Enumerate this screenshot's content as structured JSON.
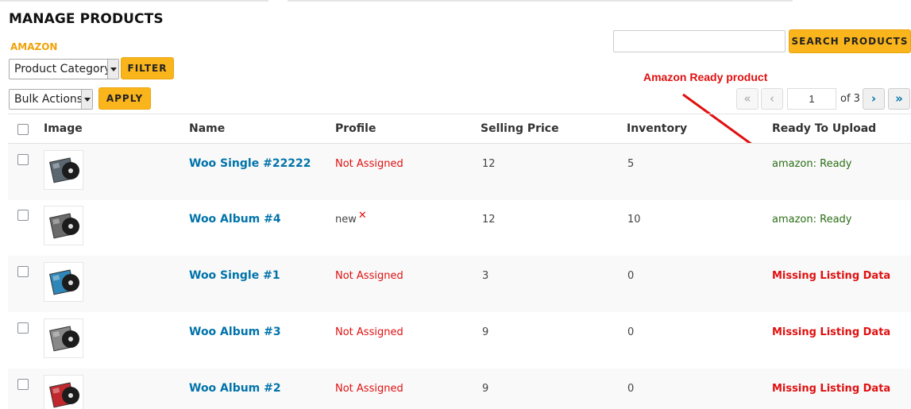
{
  "page": {
    "title": "MANAGE PRODUCTS",
    "section_label": "AMAZON"
  },
  "filters": {
    "category_select": "Product Category",
    "filter_button": "FILTER",
    "bulk_select": "Bulk Actions",
    "apply_button": "APPLY"
  },
  "search": {
    "placeholder": "",
    "button": "SEARCH PRODUCTS"
  },
  "annotation": {
    "text": "Amazon Ready product",
    "color": "#e01010"
  },
  "pagination": {
    "first": "«",
    "prev": "‹",
    "current_page": "1",
    "of_label": "of 3",
    "next": "›",
    "last": "»"
  },
  "table": {
    "columns": [
      "Image",
      "Name",
      "Profile",
      "Selling Price",
      "Inventory",
      "Ready To Upload"
    ],
    "rows": [
      {
        "name": "Woo Single #22222",
        "profile": "Not Assigned",
        "price": "12",
        "inventory": "5",
        "status": "amazon: Ready",
        "status_type": "ready",
        "thumb_color": "#5a6770"
      },
      {
        "name": "Woo Album #4",
        "profile": "new",
        "profile_flag": "✕",
        "price": "12",
        "inventory": "10",
        "status": "amazon: Ready",
        "status_type": "ready",
        "thumb_color": "#6b6b6b"
      },
      {
        "name": "Woo Single #1",
        "profile": "Not Assigned",
        "price": "3",
        "inventory": "0",
        "status": "Missing Listing Data",
        "status_type": "missing",
        "thumb_color": "#2f86b9"
      },
      {
        "name": "Woo Album #3",
        "profile": "Not Assigned",
        "price": "9",
        "inventory": "0",
        "status": "Missing Listing Data",
        "status_type": "missing",
        "thumb_color": "#888888"
      },
      {
        "name": "Woo Album #2",
        "profile": "Not Assigned",
        "price": "9",
        "inventory": "0",
        "status": "Missing Listing Data",
        "status_type": "missing",
        "thumb_color": "#c0282d"
      }
    ]
  },
  "colors": {
    "accent_button": "#fbb51c",
    "link": "#0073aa",
    "error": "#e01010",
    "ready": "#2b6e16",
    "section_label": "#f0a30a"
  }
}
